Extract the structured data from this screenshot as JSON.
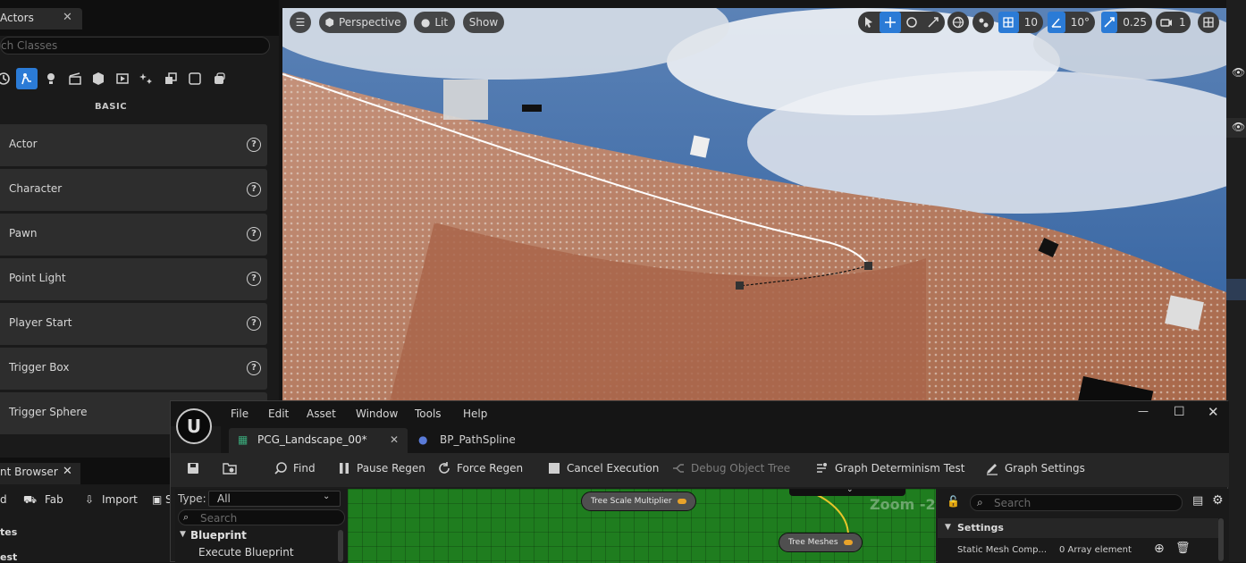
{
  "place_actors": {
    "tab_title": "Actors",
    "search_placeholder": "ch Classes",
    "category_label": "BASIC",
    "icons": [
      "clock-icon",
      "actor-place-icon",
      "light-bulb-icon",
      "cinematic-icon",
      "shape-icon",
      "media-icon",
      "effects-icon",
      "volumes-icon",
      "all-classes-icon",
      "blueprint-icon"
    ],
    "items": [
      {
        "label": "Actor"
      },
      {
        "label": "Character"
      },
      {
        "label": "Pawn"
      },
      {
        "label": "Point Light"
      },
      {
        "label": "Player Start"
      },
      {
        "label": "Trigger Box"
      },
      {
        "label": "Trigger Sphere"
      }
    ]
  },
  "content_browser": {
    "tab_title": "nt Browser",
    "toolbar": {
      "add_label": "d",
      "fab_label": "Fab",
      "import_label": "Import",
      "extra_label": "S"
    },
    "list": [
      "tes",
      "est"
    ]
  },
  "viewport": {
    "perspective_label": "Perspective",
    "lit_label": "Lit",
    "show_label": "Show",
    "grid_snap": "10",
    "angle_snap": "10°",
    "scale_snap": "0.25",
    "camera_speed": "1"
  },
  "pcg_editor": {
    "menu": [
      "File",
      "Edit",
      "Asset",
      "Window",
      "Tools",
      "Help"
    ],
    "tabs": [
      {
        "label": "PCG_Landscape_00*"
      },
      {
        "label": "BP_PathSpline"
      }
    ],
    "toolbar": {
      "find": "Find",
      "pause_regen": "Pause Regen",
      "force_regen": "Force Regen",
      "cancel_execution": "Cancel Execution",
      "debug_object_tree": "Debug Object Tree",
      "graph_determinism_test": "Graph Determinism Test",
      "graph_settings": "Graph Settings"
    },
    "palette": {
      "type_label": "Type:",
      "type_value": "All",
      "search_placeholder": "Search",
      "category": "Blueprint",
      "item": "Execute Blueprint"
    },
    "graph": {
      "zoom_label": "Zoom -2",
      "nodes": [
        {
          "label": "Tree Scale Multiplier"
        },
        {
          "label": "Tree Meshes"
        }
      ]
    },
    "details": {
      "search_placeholder": "Search",
      "section": "Settings",
      "property_name": "Static Mesh Comp...",
      "property_value": "0 Array element"
    }
  },
  "colors": {
    "accent": "#2b7bd6",
    "graph_bg": "#1f7d1f",
    "pin": "#e8a32a"
  }
}
